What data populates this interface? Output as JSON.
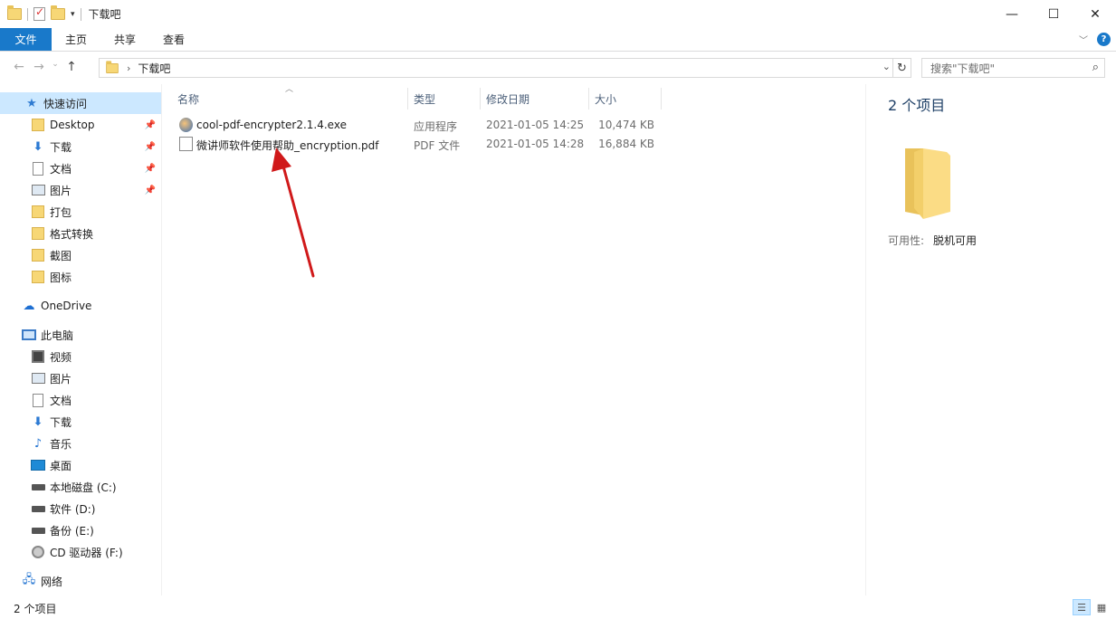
{
  "window": {
    "title": "下载吧",
    "minimize": "—",
    "maximize": "☐",
    "close": "✕"
  },
  "ribbon": {
    "tabs": [
      "文件",
      "主页",
      "共享",
      "查看"
    ],
    "expand_icon": "chevron-down-icon",
    "help": "?"
  },
  "address": {
    "crumb": "下载吧",
    "search_placeholder": "搜索\"下载吧\""
  },
  "nav": {
    "quick_access": "快速访问",
    "quick_items": [
      {
        "label": "Desktop",
        "icon": "folder-icon",
        "pinned": true
      },
      {
        "label": "下载",
        "icon": "download-icon",
        "pinned": true
      },
      {
        "label": "文档",
        "icon": "document-icon",
        "pinned": true
      },
      {
        "label": "图片",
        "icon": "pictures-icon",
        "pinned": true
      },
      {
        "label": "打包",
        "icon": "folder-icon",
        "pinned": false
      },
      {
        "label": "格式转换",
        "icon": "folder-icon",
        "pinned": false
      },
      {
        "label": "截图",
        "icon": "folder-icon",
        "pinned": false
      },
      {
        "label": "图标",
        "icon": "folder-icon",
        "pinned": false
      }
    ],
    "onedrive": "OneDrive",
    "this_pc": "此电脑",
    "pc_items": [
      {
        "label": "视频",
        "icon": "video-icon"
      },
      {
        "label": "图片",
        "icon": "pictures-icon"
      },
      {
        "label": "文档",
        "icon": "document-icon"
      },
      {
        "label": "下载",
        "icon": "download-icon"
      },
      {
        "label": "音乐",
        "icon": "music-icon"
      },
      {
        "label": "桌面",
        "icon": "desktop-icon"
      },
      {
        "label": "本地磁盘 (C:)",
        "icon": "drive-icon"
      },
      {
        "label": "软件 (D:)",
        "icon": "drive-icon"
      },
      {
        "label": "备份 (E:)",
        "icon": "drive-icon"
      },
      {
        "label": "CD 驱动器 (F:)",
        "icon": "cd-drive-icon"
      }
    ],
    "network": "网络"
  },
  "columns": {
    "name": "名称",
    "type": "类型",
    "date": "修改日期",
    "size": "大小"
  },
  "files": [
    {
      "name": "cool-pdf-encrypter2.1.4.exe",
      "type": "应用程序",
      "date": "2021-01-05 14:25",
      "size": "10,474 KB",
      "icon": "application-icon"
    },
    {
      "name": "微讲师软件使用帮助_encryption.pdf",
      "type": "PDF 文件",
      "date": "2021-01-05 14:28",
      "size": "16,884 KB",
      "icon": "pdf-file-icon"
    }
  ],
  "details": {
    "count": "2 个项目",
    "availability_label": "可用性:",
    "availability_value": "脱机可用"
  },
  "status": {
    "count": "2 个项目"
  },
  "colors": {
    "accent": "#1979ca",
    "selection": "#cce8ff",
    "annotation_arrow": "#d0191a"
  }
}
